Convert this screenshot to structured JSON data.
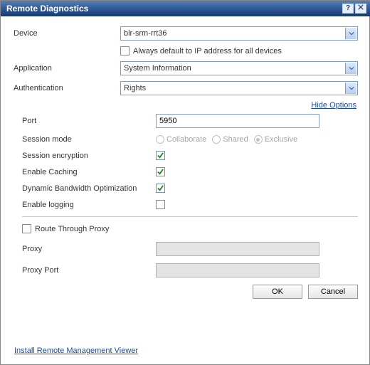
{
  "dialog": {
    "title": "Remote Diagnostics"
  },
  "fields": {
    "device_label": "Device",
    "device_value": "blr-srm-rrt36",
    "always_ip_label": "Always default to IP address for all devices",
    "application_label": "Application",
    "application_value": "System Information",
    "auth_label": "Authentication",
    "auth_value": "Rights"
  },
  "hide_options_link": "Hide Options",
  "options": {
    "port_label": "Port",
    "port_value": "5950",
    "session_mode_label": "Session mode",
    "modes": {
      "collaborate": "Collaborate",
      "shared": "Shared",
      "exclusive": "Exclusive"
    },
    "session_encryption_label": "Session encryption",
    "enable_caching_label": "Enable Caching",
    "dbo_label": "Dynamic Bandwidth Optimization",
    "enable_logging_label": "Enable logging"
  },
  "proxy": {
    "route_label": "Route Through Proxy",
    "proxy_label": "Proxy",
    "proxy_value": "",
    "proxy_port_label": "Proxy Port",
    "proxy_port_value": ""
  },
  "buttons": {
    "ok": "OK",
    "cancel": "Cancel"
  },
  "install_link": "Install Remote Management Viewer"
}
